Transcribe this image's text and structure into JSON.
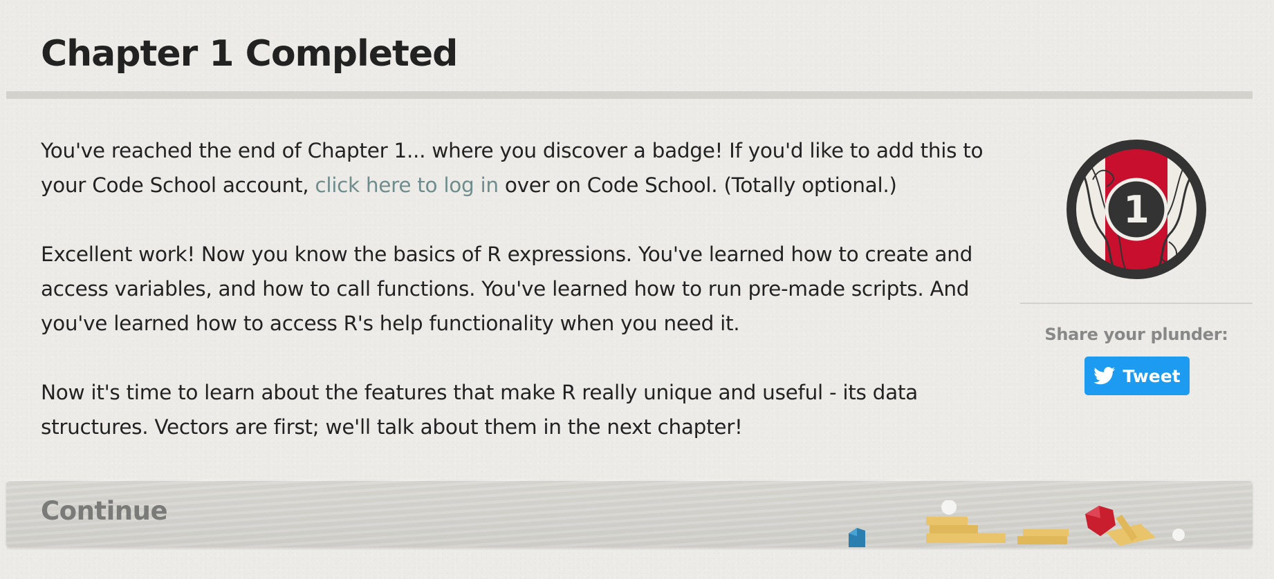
{
  "page": {
    "title": "Chapter 1 Completed"
  },
  "content": {
    "para1_before": "You've reached the end of Chapter 1... where you discover a badge! If you'd like to add this to your Code School account, ",
    "para1_link": "click here to log in",
    "para1_after": " over on Code School. (Totally optional.)",
    "para2": "Excellent work! Now you know the basics of R expressions. You've learned how to create and access variables, and how to call functions. You've learned how to run pre-made scripts. And you've learned how to access R's help functionality when you need it.",
    "para3": "Now it's time to learn about the features that make R really unique and useful - its data structures. Vectors are first; we'll talk about them in the next chapter!"
  },
  "sidebar": {
    "badge_number": "1",
    "share_label": "Share your plunder:",
    "tweet_label": "Tweet",
    "tweet_icon": "twitter-bird-icon"
  },
  "footer": {
    "continue_label": "Continue"
  },
  "colors": {
    "background": "#ecebe7",
    "link": "#6f8c8d",
    "tweet_button": "#1d9bf0",
    "badge_red": "#c8102e",
    "badge_dark": "#333333"
  }
}
